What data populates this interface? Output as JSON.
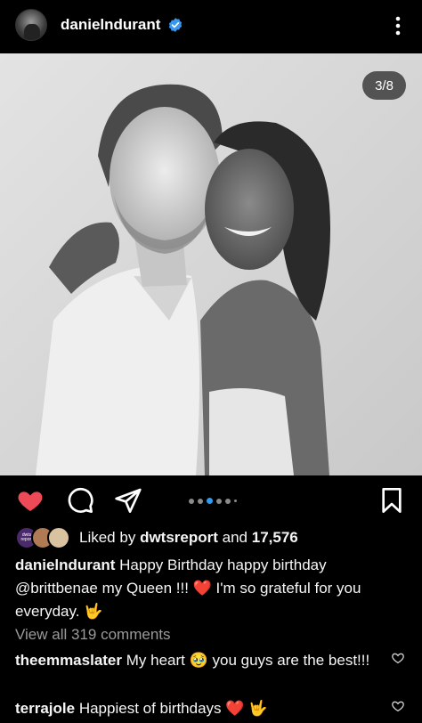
{
  "header": {
    "username": "danielndurant",
    "verified": true
  },
  "post": {
    "image_counter": "3/8",
    "liked": true,
    "carousel_dots": 6,
    "carousel_active_index": 2
  },
  "likes": {
    "prefix": "Liked by",
    "first_liker": "dwtsreport",
    "and_text": "and",
    "count": "17,576",
    "liker_avatar_text": "dwts report"
  },
  "caption": {
    "username": "danielndurant",
    "text": "Happy Birthday happy birthday @brittbenae my Queen !!! ❤️ I'm so grateful for you everyday. 🤟"
  },
  "view_all_comments": "View all 319 comments",
  "comments": [
    {
      "username": "theemmaslater",
      "text": "My heart 🥹 you guys are the best!!!"
    },
    {
      "username": "terrajole",
      "text": "Happiest of birthdays ❤️ 🤟"
    }
  ],
  "colors": {
    "background": "#000000",
    "like_red": "#ed4956",
    "verified_blue": "#3897f0",
    "carousel_active": "#2f9bf0",
    "muted_text": "#9a9a9a"
  },
  "icons": [
    "verified-badge-icon",
    "more-options-icon",
    "heart-icon",
    "comment-icon",
    "share-icon",
    "bookmark-icon",
    "comment-like-icon"
  ]
}
